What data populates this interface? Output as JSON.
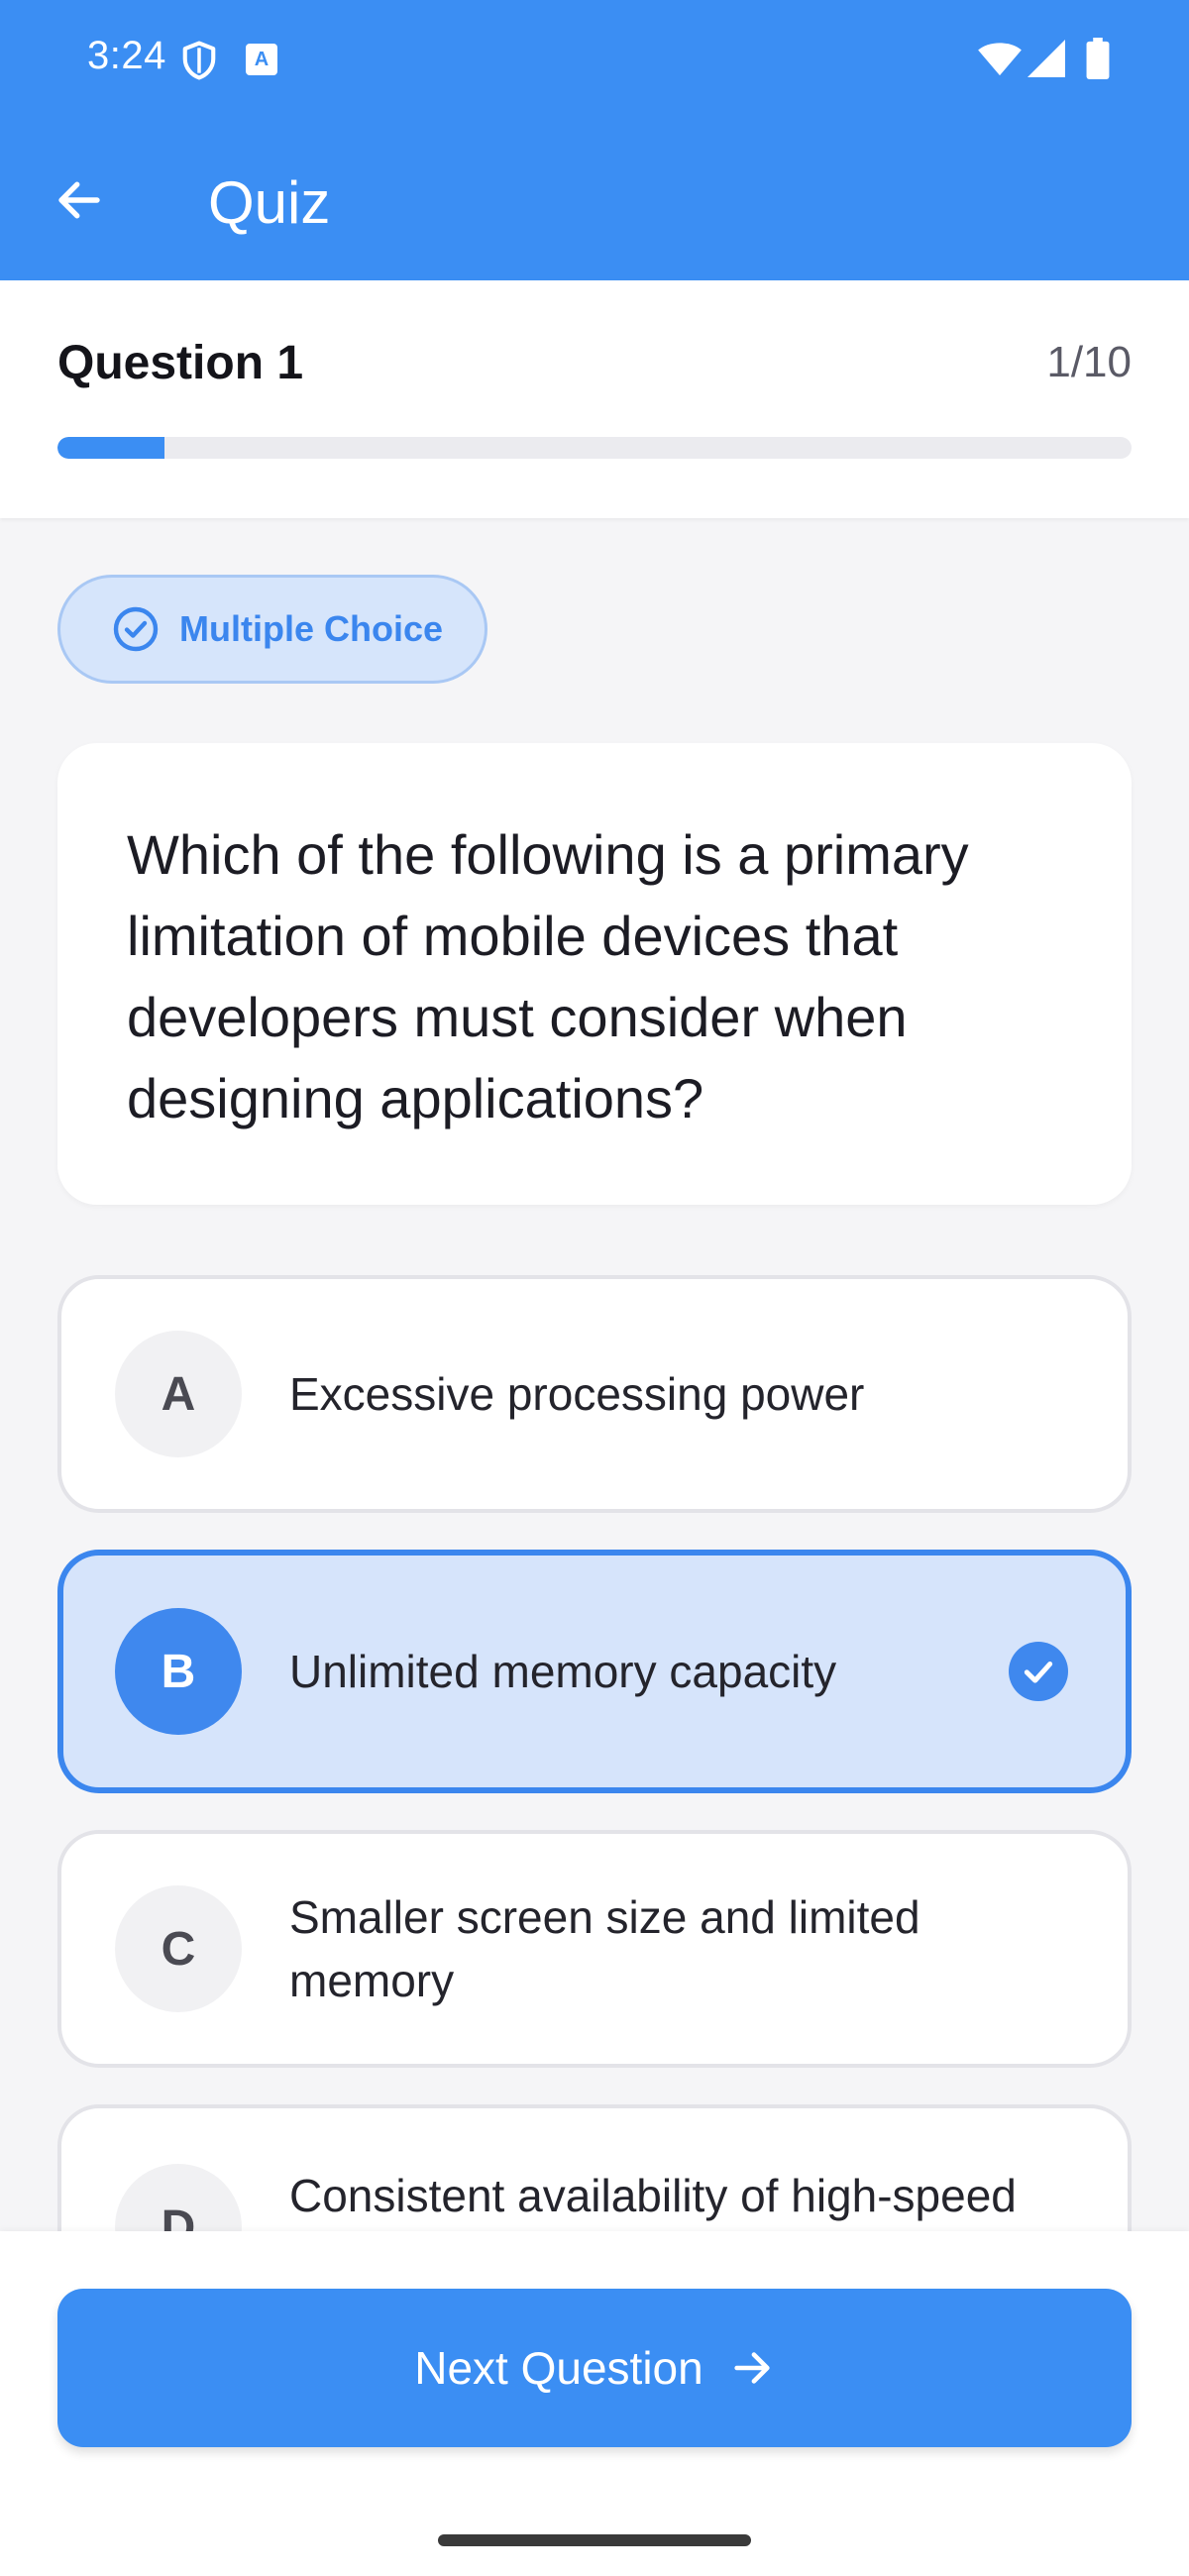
{
  "status_bar": {
    "time": "3:24",
    "icons": [
      "shield-icon",
      "keyboard-a-icon",
      "wifi-icon",
      "signal-icon",
      "battery-icon"
    ]
  },
  "app_bar": {
    "title": "Quiz",
    "back_icon": "arrow-left-icon",
    "color": "#3b8ef3"
  },
  "question_header": {
    "label": "Question 1",
    "counter": "1/10",
    "progress_fraction": 0.1
  },
  "badge": {
    "label": "Multiple Choice",
    "icon": "check-circle-icon"
  },
  "question": {
    "text": "Which of the following is a primary limitation of mobile devices that developers must consider when designing applications?"
  },
  "options": [
    {
      "letter": "A",
      "text": "Excessive processing power",
      "selected": false
    },
    {
      "letter": "B",
      "text": "Unlimited memory capacity",
      "selected": true
    },
    {
      "letter": "C",
      "text": "Smaller screen size and limited memory",
      "selected": false
    },
    {
      "letter": "D",
      "text": "Consistent availability of high-speed",
      "selected": false
    }
  ],
  "footer": {
    "next_label": "Next Question",
    "next_icon": "arrow-right-icon"
  },
  "colors": {
    "accent": "#3b8ef3",
    "selected_bg": "#d6e4fb",
    "background": "#f5f5f7"
  }
}
